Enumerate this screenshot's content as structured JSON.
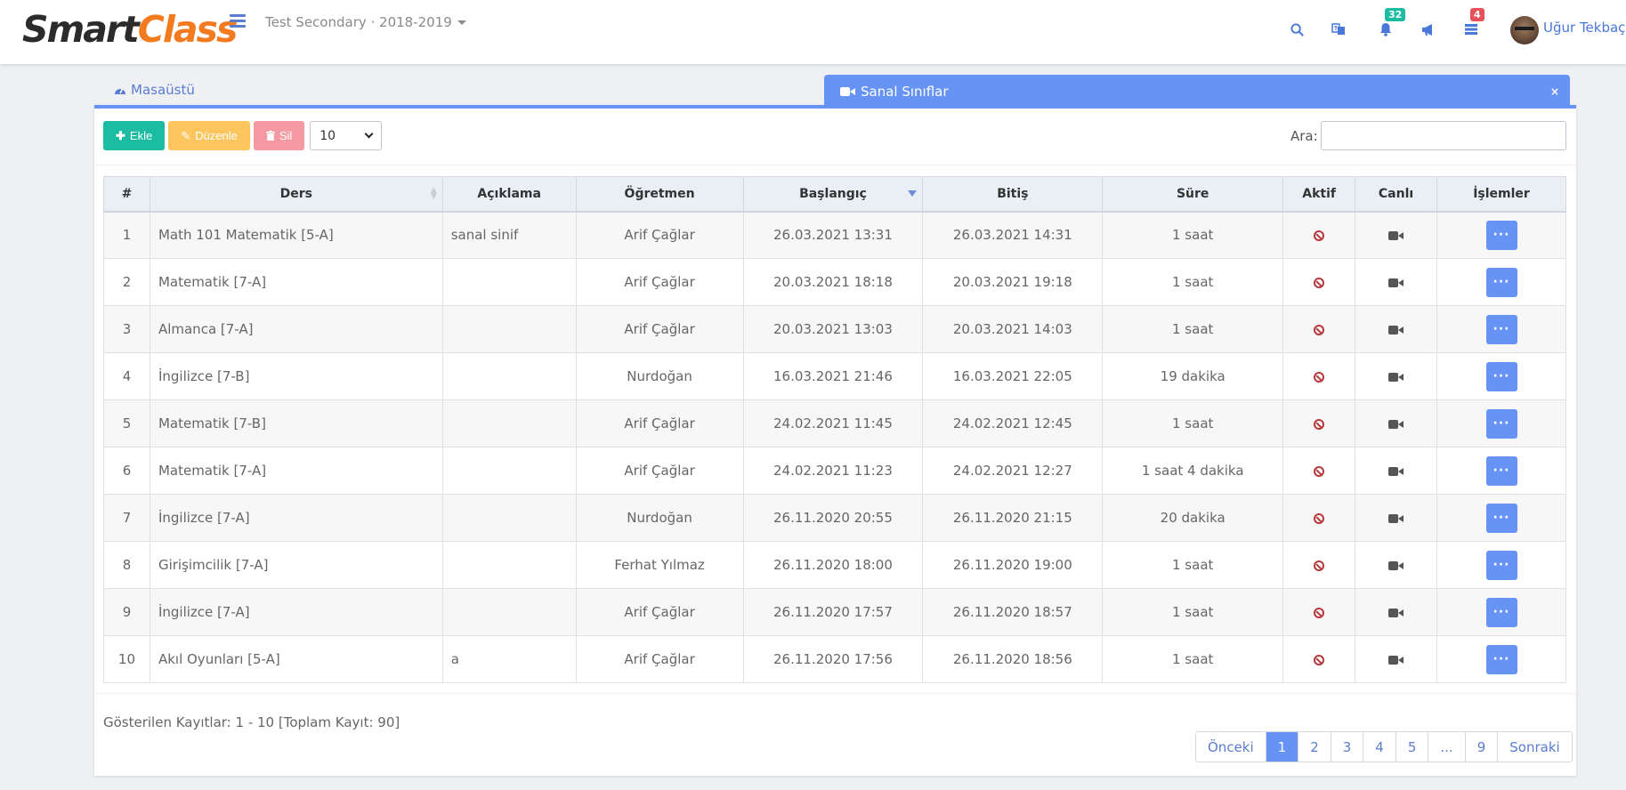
{
  "app": {
    "logo_part1": "Smart",
    "logo_part2": "Class",
    "term": "Test Secondary · 2018-2019"
  },
  "header": {
    "notifications_count": "32",
    "tasks_count": "4",
    "user_name": "Uğur Tekbaç",
    "icons": [
      "search-icon",
      "translate-icon",
      "bell-icon",
      "bullhorn-icon",
      "list-icon"
    ]
  },
  "tabs": {
    "home": "Masaüstü",
    "active": "Sanal Sınıflar",
    "close": "×"
  },
  "toolbar": {
    "add": "Ekle",
    "edit": "Düzenle",
    "delete": "Sil",
    "page_size": "10",
    "search_label": "Ara:"
  },
  "table": {
    "headers": [
      "#",
      "Ders",
      "Açıklama",
      "Öğretmen",
      "Başlangıç",
      "Bitiş",
      "Süre",
      "Aktif",
      "Canlı",
      "İşlemler"
    ],
    "rows": [
      [
        "1",
        "Math 101 Matematik [5-A]",
        "sanal sinif",
        "Arif Çağlar",
        "26.03.2021 13:31",
        "26.03.2021 14:31",
        "1 saat"
      ],
      [
        "2",
        "Matematik [7-A]",
        "",
        "Arif Çağlar",
        "20.03.2021 18:18",
        "20.03.2021 19:18",
        "1 saat"
      ],
      [
        "3",
        "Almanca [7-A]",
        "",
        "Arif Çağlar",
        "20.03.2021 13:03",
        "20.03.2021 14:03",
        "1 saat"
      ],
      [
        "4",
        "İngilizce [7-B]",
        "",
        "Nurdoğan",
        "16.03.2021 21:46",
        "16.03.2021 22:05",
        "19 dakika"
      ],
      [
        "5",
        "Matematik [7-B]",
        "",
        "Arif Çağlar",
        "24.02.2021 11:45",
        "24.02.2021 12:45",
        "1 saat"
      ],
      [
        "6",
        "Matematik [7-A]",
        "",
        "Arif Çağlar",
        "24.02.2021 11:23",
        "24.02.2021 12:27",
        "1 saat 4 dakika"
      ],
      [
        "7",
        "İngilizce [7-A]",
        "",
        "Nurdoğan",
        "26.11.2020 20:55",
        "26.11.2020 21:15",
        "20 dakika"
      ],
      [
        "8",
        "Girişimcilik [7-A]",
        "",
        "Ferhat Yılmaz",
        "26.11.2020 18:00",
        "26.11.2020 19:00",
        "1 saat"
      ],
      [
        "9",
        "İngilizce [7-A]",
        "",
        "Arif Çağlar",
        "26.11.2020 17:57",
        "26.11.2020 18:57",
        "1 saat"
      ],
      [
        "10",
        "Akıl Oyunları [5-A]",
        "a",
        "Arif Çağlar",
        "26.11.2020 17:56",
        "26.11.2020 18:56",
        "1 saat"
      ]
    ],
    "more_label": "···"
  },
  "footer": {
    "records": "Gösterilen Kayıtlar: 1 - 10 [Toplam Kayıt: 90]",
    "pagination": [
      "Önceki",
      "1",
      "2",
      "3",
      "4",
      "5",
      "...",
      "9",
      "Sonraki"
    ],
    "active_page": "1"
  },
  "colors": {
    "primary": "#6794f4",
    "green": "#1cbca3",
    "orange": "#fdc55e",
    "pink": "#f59aa3",
    "brand_orange": "#f47a20"
  }
}
